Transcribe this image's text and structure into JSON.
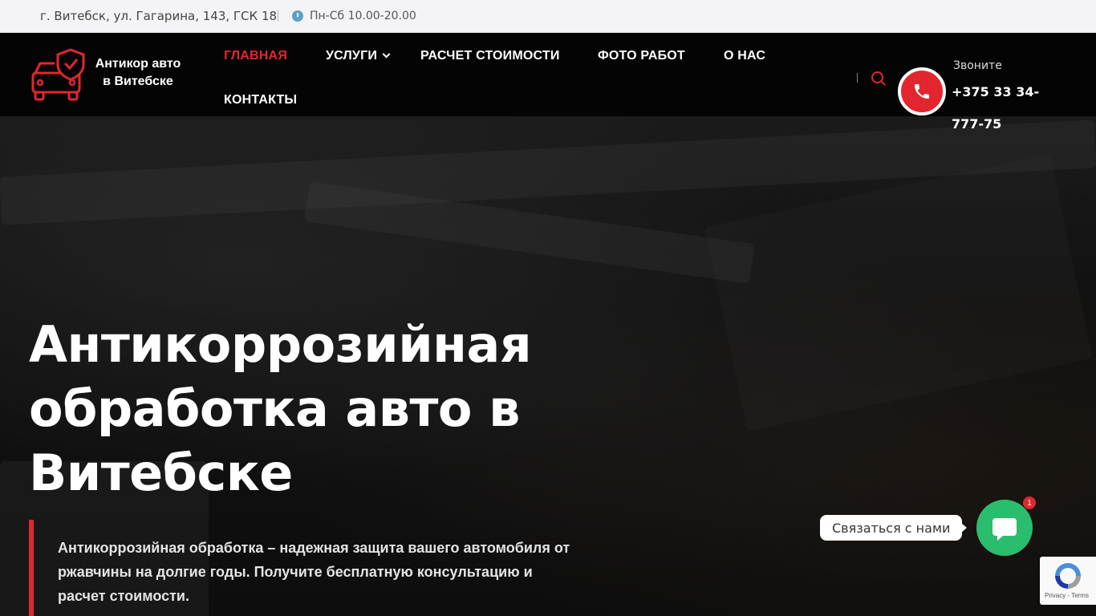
{
  "topbar": {
    "address": "г. Витебск, ул. Гагарина, 143, ГСК 18",
    "hours": "Пн-Сб 10.00-20.00"
  },
  "header": {
    "logo_line1": "Антикор авто",
    "logo_line2": "в Витебске",
    "nav": [
      {
        "label": "ГЛАВНАЯ",
        "active": true
      },
      {
        "label": "УСЛУГИ",
        "dropdown": true
      },
      {
        "label": "РАСЧЕТ СТОИМОСТИ"
      },
      {
        "label": "ФОТО РАБОТ"
      },
      {
        "label": "О НАС"
      },
      {
        "label": "КОНТАКТЫ"
      }
    ],
    "call_label": "Звоните",
    "call_number": "+375 33 34-777-75"
  },
  "hero": {
    "title": "Антикоррозийная обработка авто в Витебске",
    "subtitle": "Антикоррозийная обработка – надежная защита вашего автомобиля от ржавчины на долгие годы. Получите бесплатную консультацию и расчет стоимости."
  },
  "widget": {
    "contact_label": "Связаться с нами",
    "badge_count": "1",
    "recaptcha_text": "Privacy - Terms"
  },
  "colors": {
    "accent": "#e3262d",
    "header_bg": "#040404",
    "topbar_bg": "#f4f3f5",
    "contact_green": "#2bbd6e"
  },
  "icons": [
    "clock-icon",
    "logo-car-shield-icon",
    "chevron-down-icon",
    "search-icon",
    "phone-icon",
    "chat-icon",
    "recaptcha-icon"
  ]
}
